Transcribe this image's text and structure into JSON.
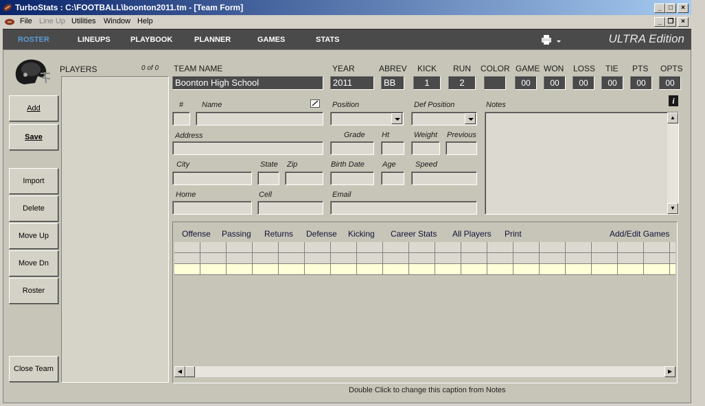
{
  "window": {
    "title": "TurboStats : C:\\FOOTBALL\\boonton2011.tm - [Team Form]"
  },
  "menu": {
    "file": "File",
    "lineup": "Line Up",
    "utilities": "Utilities",
    "window": "Window",
    "help": "Help"
  },
  "nav": {
    "roster": "ROSTER",
    "lineups": "LINEUPS",
    "playbook": "PLAYBOOK",
    "planner": "PLANNER",
    "games": "GAMES",
    "stats": "STATS",
    "edition": "ULTRA Edition"
  },
  "sidebar": {
    "add": "Add",
    "save": "Save",
    "import": "Import",
    "delete": "Delete",
    "move_up": "Move Up",
    "move_dn": "Move Dn",
    "roster": "Roster",
    "close_team": "Close Team"
  },
  "players": {
    "label": "PLAYERS",
    "count": "0 of 0"
  },
  "team": {
    "name_label": "TEAM NAME",
    "name": "Boonton High School",
    "year_label": "YEAR",
    "year": "2011",
    "abrev_label": "ABREV",
    "abrev": "BB",
    "kick_label": "KICK",
    "kick": "1",
    "run_label": "RUN",
    "run": "2",
    "color_label": "COLOR",
    "game_label": "GAME",
    "game": "00",
    "won_label": "WON",
    "won": "00",
    "loss_label": "LOSS",
    "loss": "00",
    "tie_label": "TIE",
    "tie": "00",
    "pts_label": "PTS",
    "pts": "00",
    "opts_label": "OPTS",
    "opts": "00"
  },
  "player_form": {
    "number": "#",
    "name": "Name",
    "position": "Position",
    "def_position": "Def Position",
    "notes": "Notes",
    "address": "Address",
    "grade": "Grade",
    "ht": "Ht",
    "weight": "Weight",
    "previous": "Previous",
    "city": "City",
    "state": "State",
    "zip": "Zip",
    "birth_date": "Birth Date",
    "age": "Age",
    "speed": "Speed",
    "home": "Home",
    "cell": "Cell",
    "email": "Email"
  },
  "stats_tabs": {
    "offense": "Offense",
    "passing": "Passing",
    "returns": "Returns",
    "defense": "Defense",
    "kicking": "Kicking",
    "career": "Career Stats",
    "all_players": "All Players",
    "print": "Print",
    "add_edit_games": "Add/Edit Games"
  },
  "status": {
    "caption": "Double Click to change this caption from Notes"
  },
  "colors": {
    "title_start": "#0a246a",
    "nav_bg": "#4a4a4a",
    "nav_active": "#5b9bd5",
    "panel_bg": "#c7c5b7",
    "highlight_row": "#ffffd8"
  }
}
